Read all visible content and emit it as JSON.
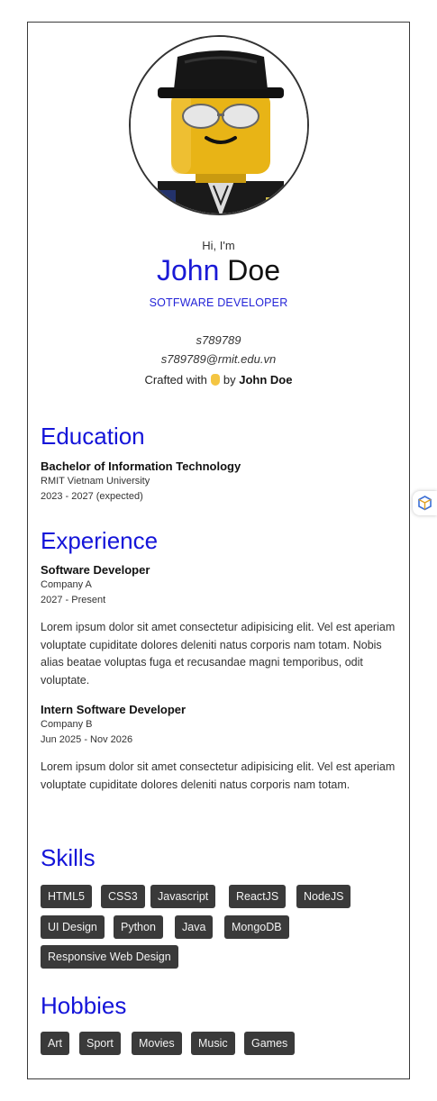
{
  "profile": {
    "greeting": "Hi, I'm",
    "first_name": "John",
    "last_name": "Doe",
    "role": "SOTFWARE DEVELOPER",
    "student_id": "s789789",
    "email": "s789789@rmit.edu.vn",
    "crafted_prefix": "Crafted with",
    "crafted_by": "by",
    "crafted_name": "John Doe",
    "avatar_icon": "lego-figure-avatar"
  },
  "education": {
    "title": "Education",
    "items": [
      {
        "degree": "Bachelor of Information Technology",
        "school": "RMIT Vietnam University",
        "period": "2023 - 2027 (expected)"
      }
    ]
  },
  "experience": {
    "title": "Experience",
    "items": [
      {
        "role": "Software Developer",
        "company": "Company A",
        "period": "2027 - Present",
        "description": "Lorem ipsum dolor sit amet consectetur adipisicing elit. Vel est aperiam voluptate cupiditate dolores deleniti natus corporis nam totam. Nobis alias beatae voluptas fuga et recusandae magni temporibus, odit voluptate."
      },
      {
        "role": "Intern Software Developer",
        "company": "Company B",
        "period": "Jun 2025 - Nov 2026",
        "description": "Lorem ipsum dolor sit amet consectetur adipisicing elit. Vel est aperiam voluptate cupiditate dolores deleniti natus corporis nam totam."
      }
    ]
  },
  "skills": {
    "title": "Skills",
    "items": [
      "HTML5",
      "CSS3",
      "Javascript",
      "ReactJS",
      "NodeJS",
      "UI Design",
      "Python",
      "Java",
      "MongoDB",
      "Responsive Web Design"
    ]
  },
  "hobbies": {
    "title": "Hobbies",
    "items": [
      "Art",
      "Sport",
      "Movies",
      "Music",
      "Games"
    ]
  },
  "colors": {
    "accent": "#1414d9",
    "tag_bg": "#3a3a3a",
    "tag_text": "#f2f2f2"
  },
  "side_widget": {
    "icon": "extension-cube-icon"
  }
}
